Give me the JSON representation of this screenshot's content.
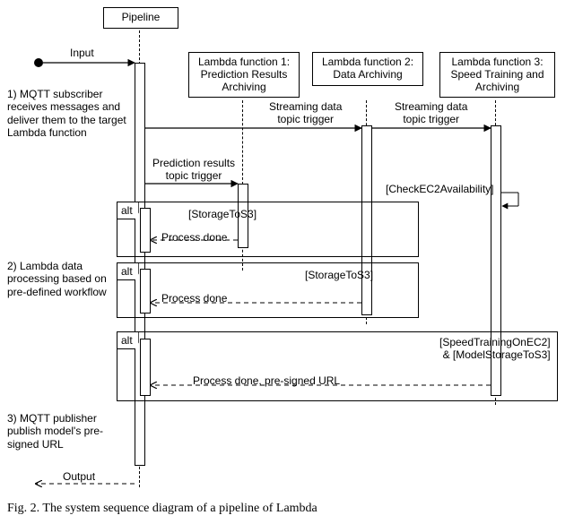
{
  "participants": {
    "pipeline": "Pipeline",
    "lambda1": "Lambda function\n1: Prediction\nResults Archiving",
    "lambda2": "Lambda function\n2: Data Archiving",
    "lambda3": "Lambda function\n3: Speed Training\nand Archiving"
  },
  "labels": {
    "input": "Input",
    "output": "Output",
    "step1": "1) MQTT subscriber\nreceives messages and\ndeliver them to the\ntarget Lambda function",
    "step2": "2) Lambda data\nprocessing based\non pre-defined\nworkflow",
    "step3": "3) MQTT publisher\npublish model's\npre-signed URL",
    "msg_stream_trigger": "Streaming data\ntopic trigger",
    "msg_pred_trigger": "Prediction results\ntopic trigger",
    "guard_storage": "[StorageToS3]",
    "guard_checkec2": "[CheckEC2Availability]",
    "guard_speed": "[SpeedTrainingOnEC2]\n& [ModelStorageToS3]",
    "process_done": "Process done",
    "process_done_url": "Process done, pre-signed URL",
    "alt": "alt",
    "caption": "Fig. 2.  The system sequence diagram of a pipeline of Lambda"
  },
  "chart_data": {
    "type": "sequence-diagram",
    "participants": [
      "Pipeline",
      "Lambda function 1: Prediction Results Archiving",
      "Lambda function 2: Data Archiving",
      "Lambda function 3: Speed Training and Archiving"
    ],
    "messages": [
      {
        "from": "external",
        "to": "Pipeline",
        "label": "Input",
        "style": "solid"
      },
      {
        "from": "Pipeline",
        "to": "Lambda2",
        "label": "Streaming data topic trigger",
        "style": "solid"
      },
      {
        "from": "Pipeline",
        "to": "Lambda3",
        "label": "Streaming data topic trigger",
        "style": "solid"
      },
      {
        "from": "Pipeline",
        "to": "Lambda1",
        "label": "Prediction results topic trigger",
        "style": "solid"
      },
      {
        "from": "Lambda1",
        "to": "Lambda1",
        "label": "[StorageToS3]",
        "style": "self"
      },
      {
        "from": "Lambda1",
        "to": "Pipeline",
        "label": "Process done",
        "style": "dashed"
      },
      {
        "from": "Lambda2",
        "to": "Lambda2",
        "label": "[StorageToS3]",
        "style": "self"
      },
      {
        "from": "Lambda2",
        "to": "Pipeline",
        "label": "Process done",
        "style": "dashed"
      },
      {
        "from": "Lambda3",
        "to": "Lambda3",
        "label": "[CheckEC2Availability]",
        "style": "self"
      },
      {
        "from": "Lambda3",
        "to": "Lambda3",
        "label": "[SpeedTrainingOnEC2] & [ModelStorageToS3]",
        "style": "self"
      },
      {
        "from": "Lambda3",
        "to": "Pipeline",
        "label": "Process done, pre-signed URL",
        "style": "dashed"
      },
      {
        "from": "Pipeline",
        "to": "external",
        "label": "Output",
        "style": "dashed"
      }
    ],
    "fragments": [
      {
        "type": "alt",
        "covers": [
          "Pipeline",
          "Lambda1"
        ],
        "guards": [
          "[StorageToS3]"
        ]
      },
      {
        "type": "alt",
        "covers": [
          "Pipeline",
          "Lambda2"
        ],
        "guards": [
          "[StorageToS3]"
        ]
      },
      {
        "type": "alt",
        "covers": [
          "Pipeline",
          "Lambda3"
        ],
        "guards": [
          "[SpeedTrainingOnEC2] & [ModelStorageToS3]"
        ]
      }
    ]
  }
}
